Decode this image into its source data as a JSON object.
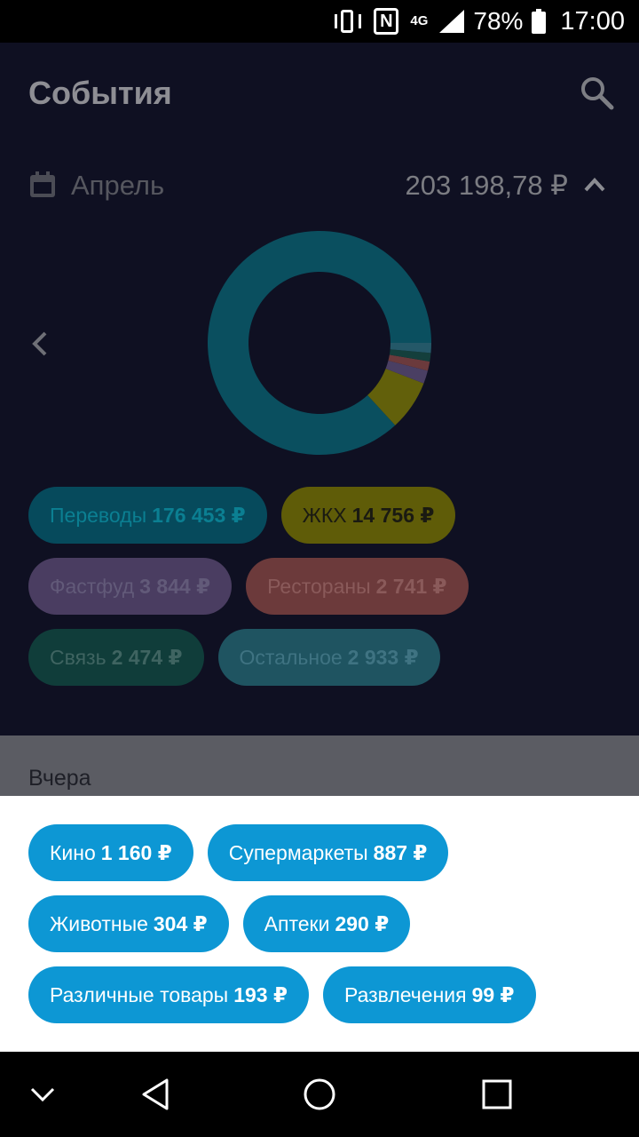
{
  "status_bar": {
    "network": "4G",
    "battery": "78%",
    "time": "17:00"
  },
  "header": {
    "title": "События",
    "search_icon": "search-icon"
  },
  "period": {
    "month": "Апрель",
    "total": "203 198,78 ₽"
  },
  "chart_data": {
    "type": "pie",
    "variant": "donut",
    "categories": [
      "Переводы",
      "ЖКХ",
      "Фастфуд",
      "Рестораны",
      "Связь",
      "Остальное"
    ],
    "values": [
      176453,
      14756,
      3844,
      2741,
      2474,
      2933
    ],
    "colors": [
      "#0a4f5f",
      "#62600b",
      "#4a3f63",
      "#6b3a3c",
      "#143f3c",
      "#245868"
    ]
  },
  "categories": [
    [
      {
        "label": "Переводы",
        "amount": "176 453 ₽",
        "bg": "#064a5c",
        "fg": "#0b7f92"
      },
      {
        "label": "ЖКХ",
        "amount": "14 756 ₽",
        "bg": "#5f5c08",
        "fg": "#1a1a12"
      }
    ],
    [
      {
        "label": "Фастфуд",
        "amount": "3 844 ₽",
        "bg": "#4a3d61",
        "fg": "#625a79"
      },
      {
        "label": "Рестораны",
        "amount": "2 741 ₽",
        "bg": "#6c3a3b",
        "fg": "#8a5a5a"
      }
    ],
    [
      {
        "label": "Связь",
        "amount": "2 474 ₽",
        "bg": "#103d3a",
        "fg": "#3f6461"
      },
      {
        "label": "Остальное",
        "amount": "2 933 ₽",
        "bg": "#1f5461",
        "fg": "#3f7382"
      }
    ]
  ],
  "section": {
    "label": "Вчера"
  },
  "sheet_categories": [
    [
      {
        "label": "Кино",
        "amount": "1 160 ₽"
      },
      {
        "label": "Супермаркеты",
        "amount": "887 ₽"
      }
    ],
    [
      {
        "label": "Животные",
        "amount": "304 ₽"
      },
      {
        "label": "Аптеки",
        "amount": "290 ₽"
      }
    ],
    [
      {
        "label": "Различные товары",
        "amount": "193 ₽"
      },
      {
        "label": "Развлечения",
        "amount": "99 ₽"
      }
    ]
  ]
}
